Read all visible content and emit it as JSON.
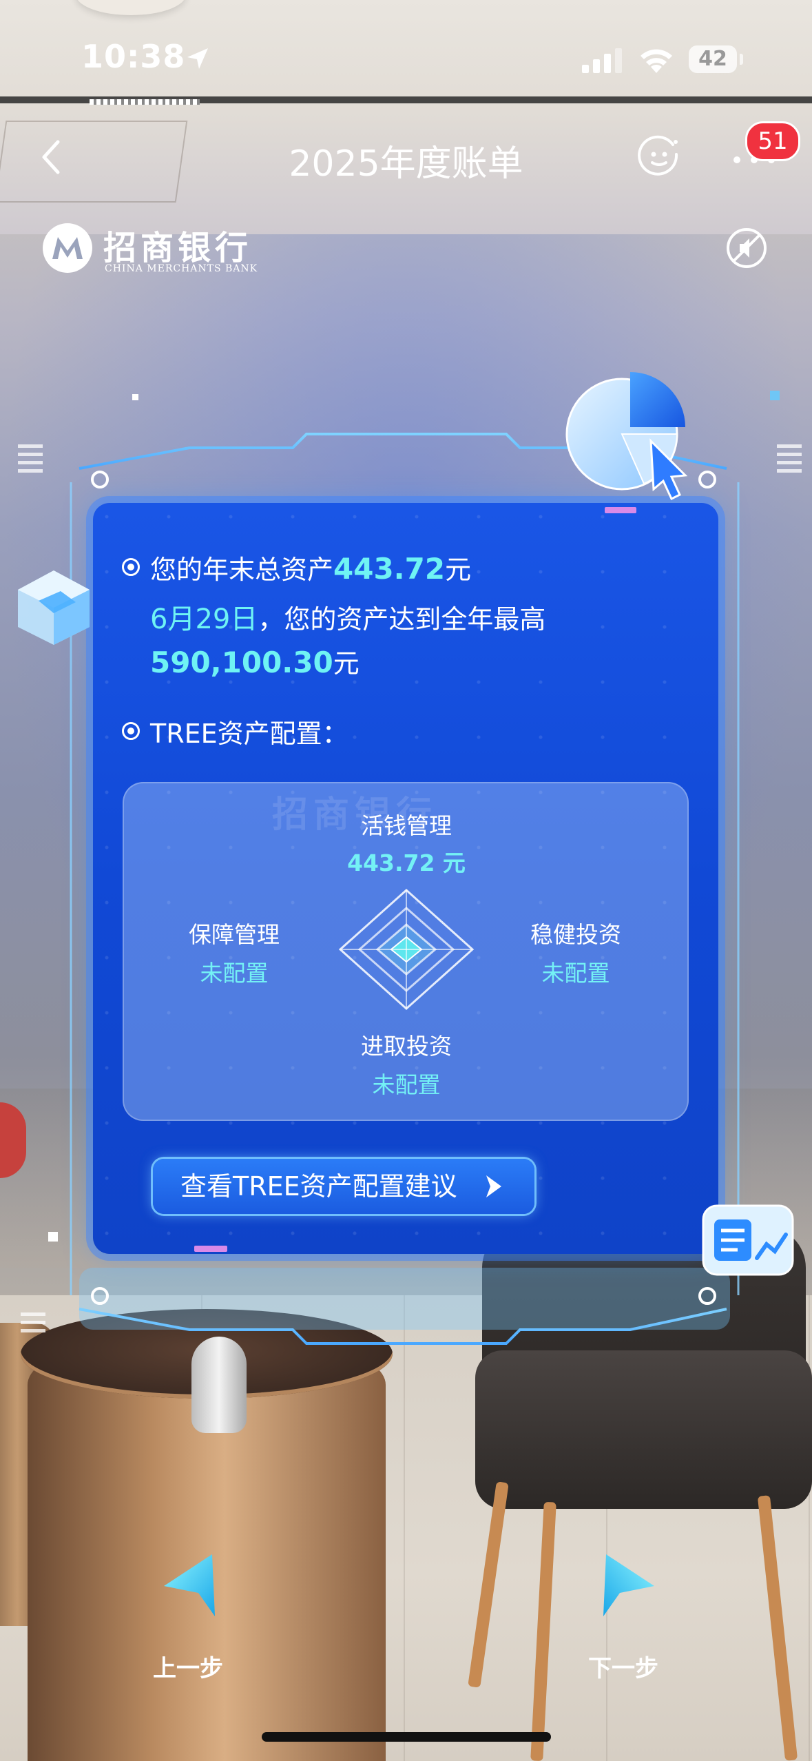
{
  "status_bar": {
    "time": "10:38",
    "battery": "42"
  },
  "nav": {
    "title": "2025年度账单",
    "badge": "51"
  },
  "brand": {
    "name_cn": "招商银行",
    "name_en": "CHINA MERCHANTS BANK"
  },
  "summary": {
    "assets_prefix": "您的年末总资产",
    "assets_value": "443.72",
    "assets_unit": "元",
    "peak_date": "6月29日",
    "peak_text": "，您的资产达到全年最高",
    "peak_value": "590,100.30",
    "peak_unit": "元"
  },
  "allocation": {
    "section_title": "TREE资产配置：",
    "top": {
      "label": "活钱管理",
      "value": "443.72 元"
    },
    "left": {
      "label": "保障管理",
      "value": "未配置"
    },
    "right": {
      "label": "稳健投资",
      "value": "未配置"
    },
    "bottom": {
      "label": "进取投资",
      "value": "未配置"
    }
  },
  "cta": {
    "label": "查看TREE资产配置建议"
  },
  "footer": {
    "prev": "上一步",
    "next": "下一步"
  },
  "colors": {
    "panel": "#1149d6",
    "highlight": "#6ff3f4",
    "badge": "#f0323f",
    "accent_pink": "#d98ae8"
  }
}
